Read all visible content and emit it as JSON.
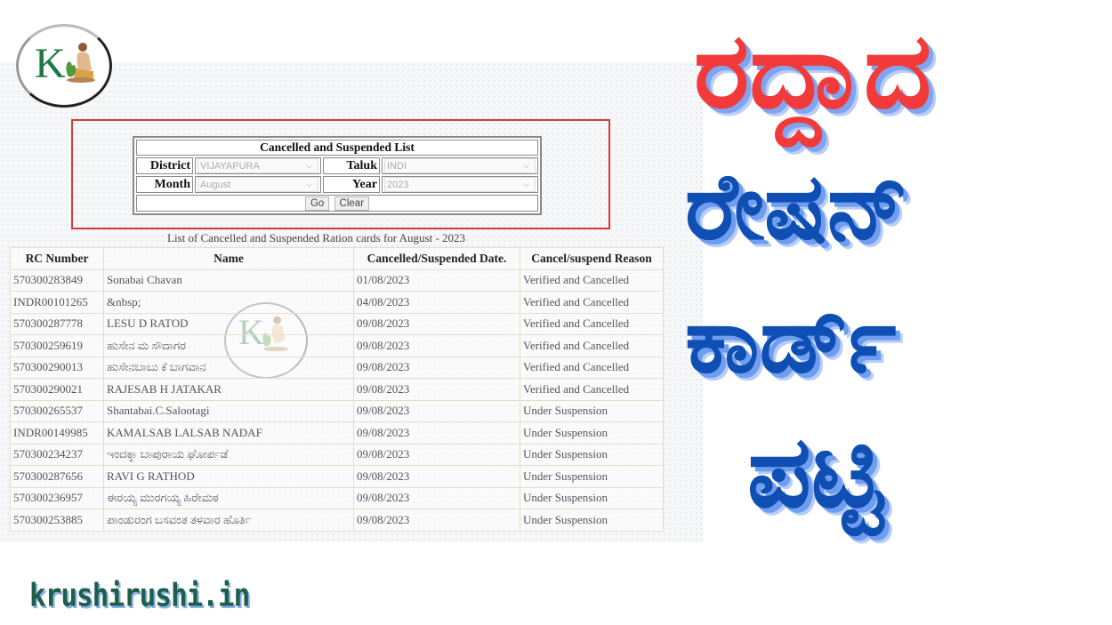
{
  "logo": {
    "letter": "K",
    "icon": "krushirushi-farmer-logo"
  },
  "watermark": {
    "letter": "K",
    "icon": "krushirushi-farmer-logo"
  },
  "form": {
    "title": "Cancelled and Suspended List",
    "district_label": "District",
    "district_value": "VIJAYAPURA",
    "taluk_label": "Taluk",
    "taluk_value": "INDI",
    "month_label": "Month",
    "month_value": "August",
    "year_label": "Year",
    "year_value": "2023",
    "go_label": "Go",
    "clear_label": "Clear",
    "chevron_icon": "chevron-down-icon"
  },
  "list": {
    "caption": "List of Cancelled and Suspended Ration cards for August - 2023",
    "headers": [
      "RC Number",
      "Name",
      "Cancelled/Suspended Date.",
      "Cancel/suspend Reason"
    ],
    "rows": [
      [
        "570300283849",
        "Sonabai Chavan",
        "01/08/2023",
        "Verified and Cancelled"
      ],
      [
        "INDR00101265",
        "&nbsp;",
        "04/08/2023",
        "Verified and Cancelled"
      ],
      [
        "570300287778",
        "LESU D RATOD",
        "09/08/2023",
        "Verified and Cancelled"
      ],
      [
        "570300259619",
        "ಹುಸೇನ ಮ ಸೌದಾಗರ",
        "09/08/2023",
        "Verified and Cancelled"
      ],
      [
        "570300290013",
        "ಹುಸೇನಬಾಬು ಕೆ ಬಾಗವಾನ",
        "09/08/2023",
        "Verified and Cancelled"
      ],
      [
        "570300290021",
        "RAJESAB H JATAKAR",
        "09/08/2023",
        "Verified and Cancelled"
      ],
      [
        "570300265537",
        "Shantabai.C.Salootagi",
        "09/08/2023",
        "Under Suspension"
      ],
      [
        "INDR00149985",
        "KAMALSAB LALSAB NADAF",
        "09/08/2023",
        "Under Suspension"
      ],
      [
        "570300234237",
        "ಇಂದಕ್ಕಾ ಬಾಪುರಾಯ ಘೋರ್ಪಡೆ",
        "09/08/2023",
        "Under Suspension"
      ],
      [
        "570300287656",
        "RAVI G RATHOD",
        "09/08/2023",
        "Under Suspension"
      ],
      [
        "570300236957",
        "ಈರಯ್ಯ ಮುರಗಯ್ಯ ಹಿರೇಮಠ",
        "09/08/2023",
        "Under Suspension"
      ],
      [
        "570300253885",
        "ಪಾಂಡುರಂಗ ಬಸವಂತ ತಳವಾರ ಹೊರ್ತಿ",
        "09/08/2023",
        "Under Suspension"
      ]
    ]
  },
  "headline": {
    "line1": "ರದ್ದಾದ",
    "line2": "ರೇಷನ್",
    "line3": "ಕಾರ್ಡ್",
    "line4": "ಪಟ್ಟಿ",
    "color_red": "#f23a3a",
    "color_blue": "#0f4fb4"
  },
  "site": {
    "label": "krushirushi.in"
  }
}
